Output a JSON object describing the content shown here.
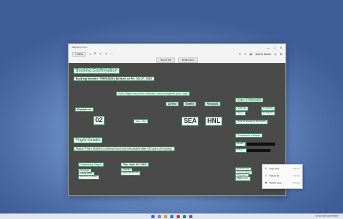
{
  "window": {
    "title": "Shipping Form",
    "controls": [
      "—",
      "□",
      "✕"
    ]
  },
  "toolbar": {
    "new_label": "+ New",
    "add_label": "Add to Notes"
  },
  "subbar": {
    "sign_label": "Sign & Fill",
    "draft_label": "Draft notes"
  },
  "booking": {
    "heading": "Booking Confirmation",
    "number": "Booking Number: 795054826 | Booked on Fri, Oct 27, 2023",
    "success": "Your flight has been booked, now complete your trip!",
    "airline": "Airline",
    "from_city": "Seattle",
    "to_city": "Honolulu",
    "departs_label": "Departs on",
    "date": "02",
    "day": "Nov Thu",
    "from_code": "SEA",
    "to_code": "HNL",
    "details_heading": "Flight Details",
    "status": "Status: This e-ticket is confirmed and non-refundable after 48 hours of booking.",
    "departing_heading": "Departing Flight",
    "date_full": "Thu, Nov 02, 2023",
    "flight_info": [
      "Nonstop",
      "Flight 0000",
      "Economy Class"
    ],
    "route_info": [
      "Seattle",
      "SEA 08:00 AM"
    ]
  },
  "side": {
    "order_heading": "Order #795054826",
    "order_rows": [
      "Subtotal",
      "$ 000.00",
      "Taxes",
      "$ 000.00"
    ],
    "total_line": "Total (3 travelers)  $ 000.00",
    "customer_heading": "Customer Details",
    "customer_rows": [
      "Email",
      "Phone"
    ],
    "ending_lines": [
      "Ending Info",
      "Card ending",
      "Payment",
      "Billing info"
    ]
  },
  "menu": {
    "items": [
      {
        "label": "Copy text",
        "shortcut": "Ctrl+C"
      },
      {
        "label": "Select all",
        "shortcut": "Ctrl+A"
      },
      {
        "label": "Switch view",
        "shortcut": "Ctrl+M"
      }
    ]
  },
  "taskbar": {
    "time": "10:10 AM",
    "date": "10/27/2023"
  },
  "colors": {
    "accent": "#2e8b57",
    "doc_bg": "#4a4a4a",
    "wall": "#5f7fb4"
  }
}
